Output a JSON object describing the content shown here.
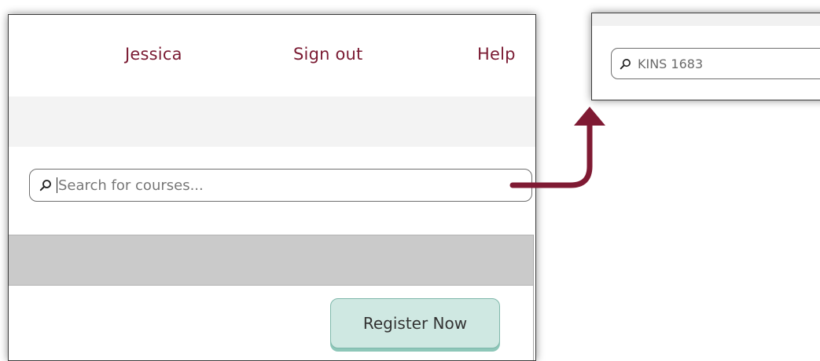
{
  "nav": {
    "user_label": "Jessica",
    "signout_label": "Sign out",
    "help_label": "Help"
  },
  "search": {
    "placeholder": "Search for courses...",
    "icon": "search-icon"
  },
  "actions": {
    "register_label": "Register Now"
  },
  "zoom_panel": {
    "search_value": "KINS 1683",
    "icon": "search-icon"
  },
  "colors": {
    "nav_link": "#7a1a32",
    "arrow": "#7f1a33",
    "register_bg": "#cfe8e2",
    "header_bar": "#cacaca"
  }
}
